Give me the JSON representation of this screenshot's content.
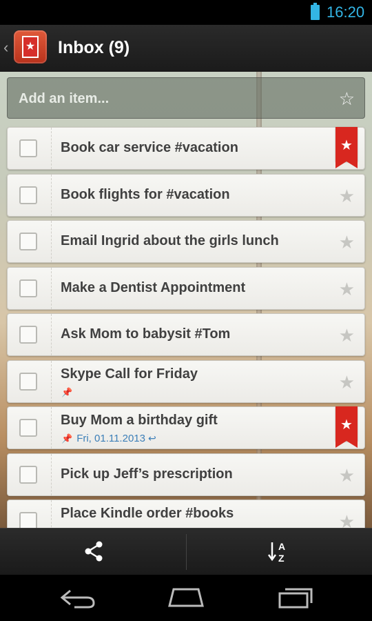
{
  "status_bar": {
    "time": "16:20"
  },
  "action_bar": {
    "title": "Inbox (9)"
  },
  "add_item": {
    "placeholder": "Add an item..."
  },
  "tasks": [
    {
      "label": "Book car service #vacation",
      "starred": true
    },
    {
      "label": "Book flights for #vacation",
      "starred": false
    },
    {
      "label": "Email Ingrid about the girls lunch",
      "starred": false
    },
    {
      "label": "Make a Dentist Appointment",
      "starred": false
    },
    {
      "label": "Ask Mom to babysit #Tom",
      "starred": false
    },
    {
      "label": "Skype Call for Friday",
      "starred": false,
      "has_note": true
    },
    {
      "label": "Buy Mom a birthday gift",
      "starred": true,
      "due": "Fri, 01.11.2013",
      "repeat": true
    },
    {
      "label": "Pick up Jeff’s prescription",
      "starred": false
    },
    {
      "label": "Place Kindle order #books",
      "starred": false
    }
  ],
  "icons": {
    "share": "share-icon",
    "sort": "sort-az-icon",
    "star": "star-icon",
    "pin": "pin-icon"
  },
  "colors": {
    "accent": "#33b5e5",
    "ribbon": "#d8271f",
    "due_text": "#3c7fb8"
  }
}
